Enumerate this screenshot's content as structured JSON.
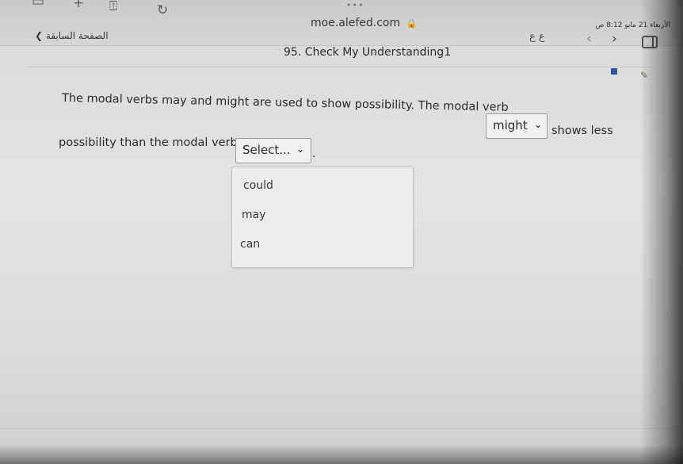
{
  "browser": {
    "url": "moe.alefed.com",
    "status_time": "الأربعاء 21 مايو 8:12 ص",
    "reader_label": "ع ع"
  },
  "nav": {
    "back_label": "الصفحة السابقة",
    "page_title": "95. Check My Understanding1"
  },
  "question": {
    "line1": "The modal verbs may and might are used to show possibility. The modal verb",
    "select1_value": "might",
    "line1_tail": "shows less",
    "line2": "possibility than the modal verb",
    "select2_value": "Select...",
    "line2_tail": "."
  },
  "dropdown": {
    "options": [
      "could",
      "may",
      "can"
    ]
  },
  "icons": {
    "tabs": "tabs-icon",
    "new_tab": "plus-icon",
    "share": "share-icon",
    "reload": "reload-icon",
    "lock": "lock-icon",
    "back": "chevron-left-icon",
    "forward": "chevron-right-icon",
    "sidebar": "sidebar-icon",
    "note": "note-icon",
    "pen": "pen-icon"
  },
  "colors": {
    "accent": "#2c3e66",
    "note": "#2d55a8",
    "pen": "#5d7e3a"
  }
}
